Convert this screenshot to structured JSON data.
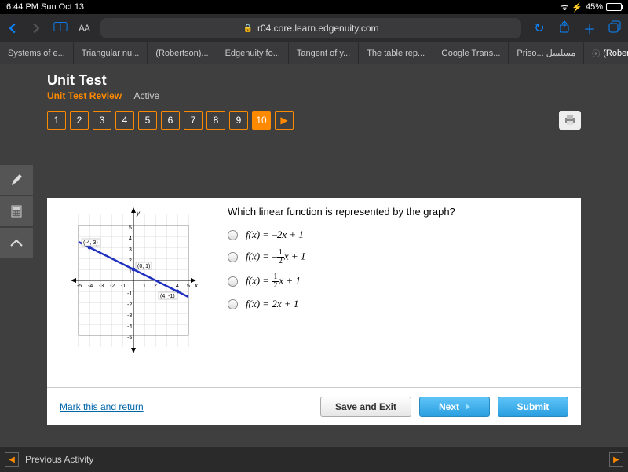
{
  "status": {
    "left": "6:44 PM  Sun Oct 13",
    "battery_pct": "45%"
  },
  "browser": {
    "aa": "AA",
    "url": "r04.core.learn.edgenuity.com"
  },
  "tabs": [
    "Systems of e...",
    "Triangular nu...",
    "(Robertson)...",
    "Edgenuity fo...",
    "Tangent of y...",
    "The table rep...",
    "Google Trans...",
    "Priso... مسلسل",
    "(Robertso..."
  ],
  "header": {
    "title": "Unit Test",
    "review": "Unit Test Review",
    "active": "Active"
  },
  "qnums": [
    "1",
    "2",
    "3",
    "4",
    "5",
    "6",
    "7",
    "8",
    "9",
    "10"
  ],
  "current_q": "10",
  "question": "Which linear function is represented by the graph?",
  "options": {
    "a_pre": "f(x) = –2x + 1",
    "b_pre": "f(x) = –",
    "b_post": "x + 1",
    "c_pre": "f(x) = ",
    "c_post": "x + 1",
    "d_pre": "f(x) = 2x + 1",
    "frac_num": "1",
    "frac_den": "2"
  },
  "footer": {
    "mark": "Mark this and return",
    "save": "Save and Exit",
    "next": "Next",
    "submit": "Submit"
  },
  "bottom": {
    "prev": "Previous Activity"
  },
  "chart_data": {
    "type": "line",
    "title": "",
    "xlabel": "x",
    "ylabel": "y",
    "xlim": [
      -5,
      5
    ],
    "ylim": [
      -5,
      5
    ],
    "points_labeled": [
      {
        "x": -4,
        "y": 3,
        "label": "(-4, 3)"
      },
      {
        "x": 0,
        "y": 1,
        "label": "(0, 1)"
      },
      {
        "x": 4,
        "y": -1,
        "label": "(4, -1)"
      }
    ],
    "series": [
      {
        "name": "line",
        "x": [
          -5,
          5
        ],
        "y": [
          3.5,
          -1.5
        ]
      }
    ]
  }
}
